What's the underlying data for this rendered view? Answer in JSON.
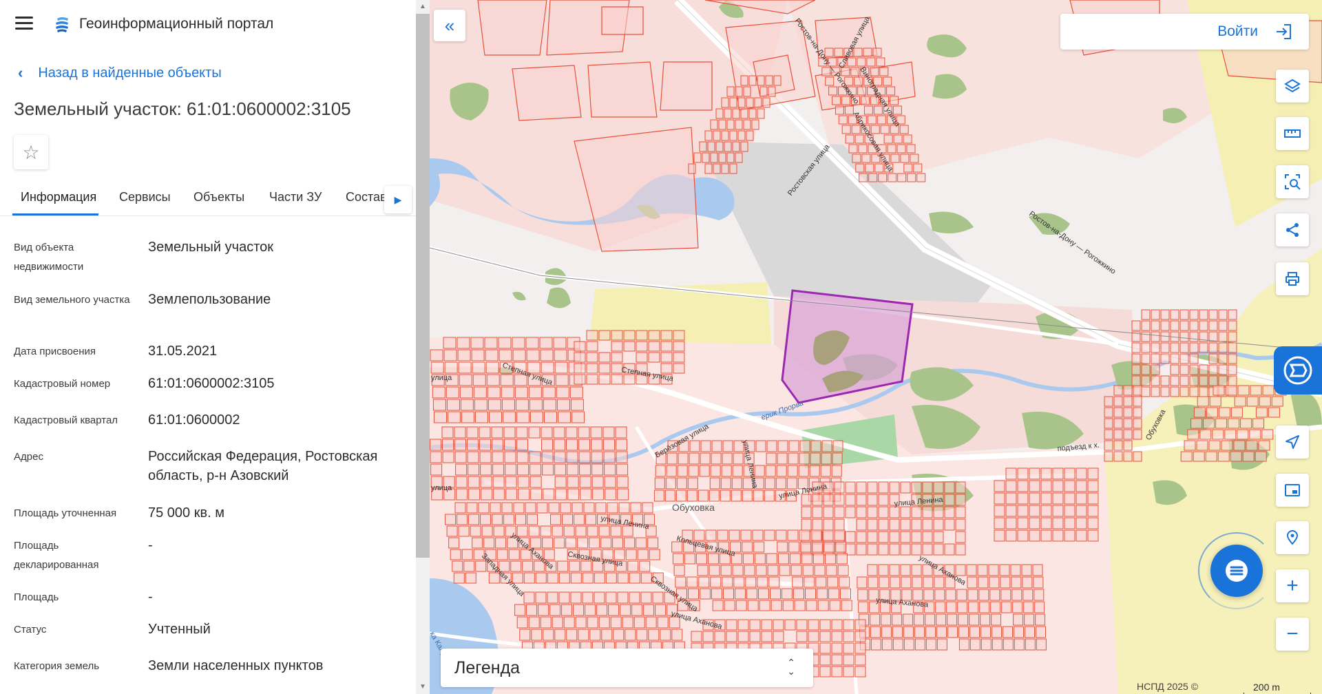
{
  "header": {
    "app_title": "Геоинформационный портал"
  },
  "nav": {
    "back_label": "Назад в найденные объекты"
  },
  "object": {
    "title": "Земельный участок: 61:01:0600002:3105"
  },
  "tabs": [
    "Информация",
    "Сервисы",
    "Объекты",
    "Части ЗУ",
    "Состав"
  ],
  "info_rows": [
    {
      "label": "Вид объекта недвижимости",
      "value": "Земельный участок"
    },
    {
      "label": "Вид земельного участка",
      "value": "Землепользование"
    },
    {
      "label": "Дата присвоения",
      "value": "31.05.2021"
    },
    {
      "label": "Кадастровый номер",
      "value": "61:01:0600002:3105"
    },
    {
      "label": "Кадастровый квартал",
      "value": "61:01:0600002"
    },
    {
      "label": "Адрес",
      "value": "Российская Федерация, Ростовская область, р-н Азовский"
    },
    {
      "label": "Площадь уточненная",
      "value": "75 000 кв. м"
    },
    {
      "label": "Площадь декларированная",
      "value": "-"
    },
    {
      "label": "Площадь",
      "value": "-"
    },
    {
      "label": "Статус",
      "value": "Учтенный"
    },
    {
      "label": "Категория земель",
      "value": "Земли населенных пунктов"
    }
  ],
  "map": {
    "login_label": "Войти",
    "legend_label": "Легенда",
    "copyright": "НСПД 2025 ©",
    "scale": "200 m",
    "labels": {
      "road_rostov_1": "Ростов-на-Дону — Рогожкино",
      "road_rostov_2": "Ростов-на-Дону — Рогожкино",
      "sliv": "Сливовая улица",
      "vinograd": "Виноградная улица",
      "abrikos": "Абрикосовая улица",
      "rostov_st": "Ростовская улица",
      "stepnaya_1": "Степная улица",
      "stepnaya_2": "Степная улица",
      "ulitsa_1": "улица",
      "ulitsa_2": "улица",
      "erik": "ерик Прорва",
      "berezov": "Берёзовая улица",
      "lenina_v": "улица Ленина",
      "lenina_1": "улица Ленина",
      "lenina_2": "улица Ленина",
      "lenina_3": "улица Ленина",
      "obukhovka": "Обуховка",
      "koltsevaya": "Кольцевая улица",
      "akhanova_1": "улица Аханова",
      "akhanova_2": "улица Аханова",
      "akhanova_3": "улица Аханова",
      "skvoznaya_1": "Сквозная улица",
      "skvoznaya_2": "Сквозная улица",
      "zapadnaya": "Западная улица",
      "akhanova_4": "улица Аханова",
      "obukhovka_r": "Обуховка",
      "podezd": "подъезд к х.",
      "kal": "ка Калу"
    }
  },
  "colors": {
    "accent": "#1a73d9",
    "parcel_fill": "#f7d4d0",
    "parcel_stroke": "#e8503a",
    "selected_stroke": "#9c27b0",
    "water": "#a9c9ef",
    "greenery": "#a9c48a",
    "agro": "#f6efb4",
    "industrial": "#d6d6d6"
  }
}
